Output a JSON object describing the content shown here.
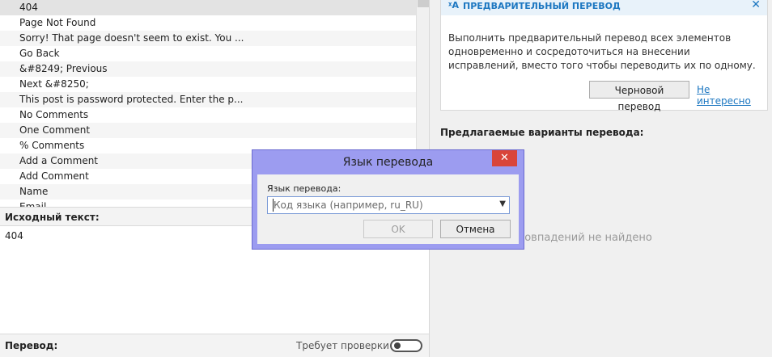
{
  "source_list": {
    "items": [
      "404",
      "Page  Not Found",
      "Sorry! That page doesn't seem to exist. You ...",
      "Go Back",
      "&#8249; Previous",
      "Next &#8250;",
      "This post is password protected. Enter the p...",
      "No Comments",
      "One Comment",
      "% Comments",
      "Add a Comment",
      "Add Comment",
      "Name",
      "Email"
    ]
  },
  "source_pane": {
    "label": "Исходный текст:",
    "text": "404"
  },
  "translation_pane": {
    "label": "Перевод:",
    "fuzzy_label": "Требует проверки"
  },
  "pretranslate": {
    "title": "ПРЕДВАРИТЕЛЬНЫЙ ПЕРЕВОД",
    "icon": "translate-icon",
    "body": "Выполнить предварительный перевод всех элементов одновременно и сосредоточиться на внесении исправлений, вместо того чтобы переводить их по одному.",
    "draft_button": "Черновой перевод",
    "not_interested": "Не интересно",
    "close_icon": "close-icon"
  },
  "suggestions": {
    "title": "Предлагаемые варианты перевода:",
    "empty": "Совпадений не найдено"
  },
  "dialog": {
    "title": "Язык перевода",
    "close": "✕",
    "field_label": "Язык перевода:",
    "placeholder": "Код языка (например, ru_RU)",
    "ok": "OK",
    "cancel": "Отмена"
  },
  "colors": {
    "accent": "#1c77c1",
    "dialog_frame": "#9c9cf0",
    "close_button": "#d9453a"
  }
}
